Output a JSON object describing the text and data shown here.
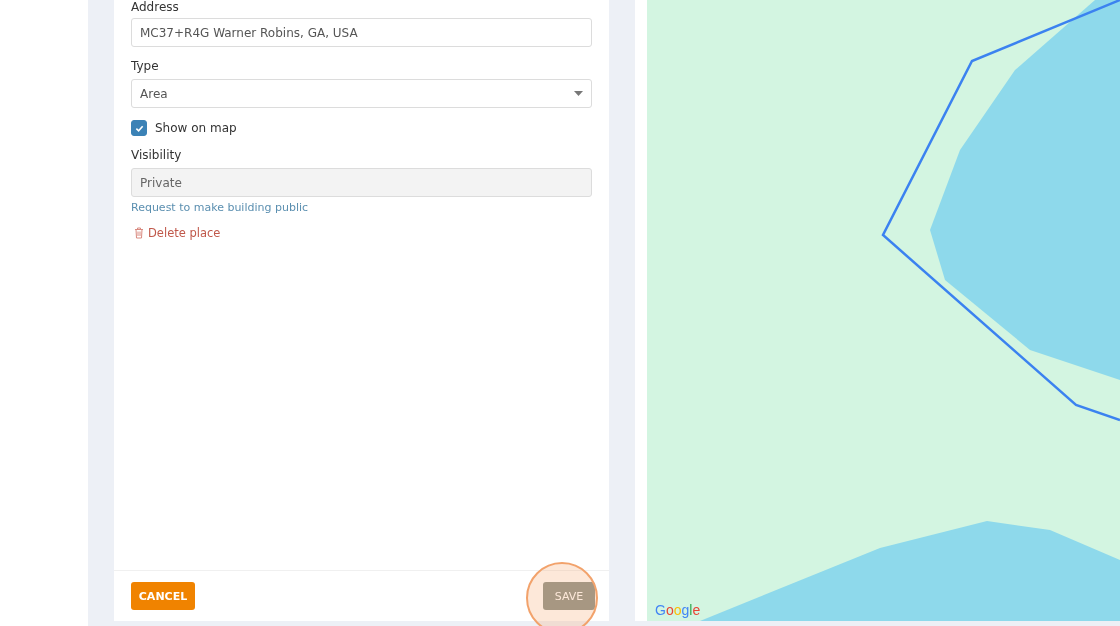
{
  "form": {
    "fields": [
      {
        "kind": "text",
        "label": "Address",
        "value": "MC37+R4G Warner Robins, GA, USA",
        "disabled": false
      },
      {
        "kind": "select",
        "label": "Type",
        "value": "Area",
        "disabled": false
      },
      {
        "kind": "checkbox",
        "label": "Show on map",
        "checked": true
      },
      {
        "kind": "text",
        "label": "Visibility",
        "value": "Private",
        "disabled": true
      }
    ],
    "request_link": "Request to make building public",
    "delete_link": "Delete place"
  },
  "footer": {
    "cancel": "CANCEL",
    "save": {
      "label": "SAVE",
      "disabled": true,
      "highlighted": true
    }
  },
  "map": {
    "attribution": "Google"
  }
}
